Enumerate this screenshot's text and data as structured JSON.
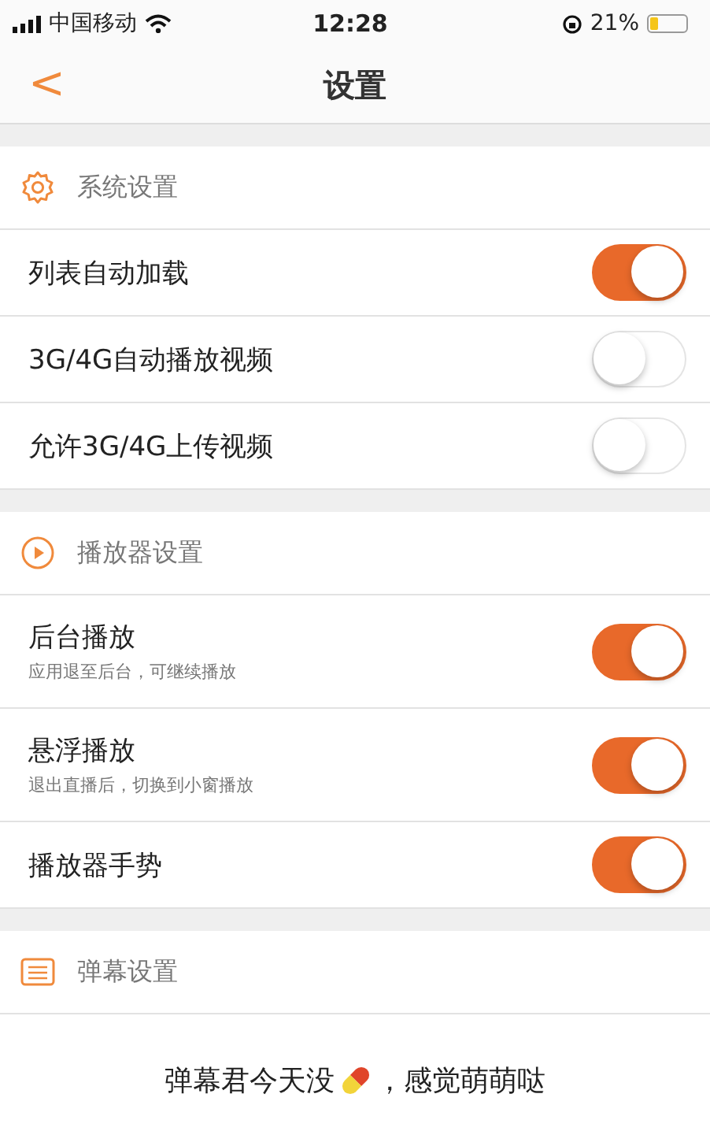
{
  "status_bar": {
    "carrier": "中国移动",
    "time": "12:28",
    "battery_text": "21%"
  },
  "nav": {
    "back": "<",
    "title": "设置"
  },
  "sections": [
    {
      "kind": "gear",
      "title": "系统设置",
      "rows": [
        {
          "label": "列表自动加载",
          "on": true
        },
        {
          "label": "3G/4G自动播放视频",
          "on": false
        },
        {
          "label": "允许3G/4G上传视频",
          "on": false
        }
      ]
    },
    {
      "kind": "play",
      "title": "播放器设置",
      "rows": [
        {
          "label": "后台播放",
          "sub": "应用退至后台，可继续播放",
          "on": true
        },
        {
          "label": "悬浮播放",
          "sub": "退出直播后，切换到小窗播放",
          "on": true
        },
        {
          "label": "播放器手势",
          "on": true
        }
      ]
    },
    {
      "kind": "list",
      "title": "弹幕设置"
    }
  ],
  "message": {
    "before": "弹幕君今天没",
    "after": "，感觉萌萌哒"
  }
}
